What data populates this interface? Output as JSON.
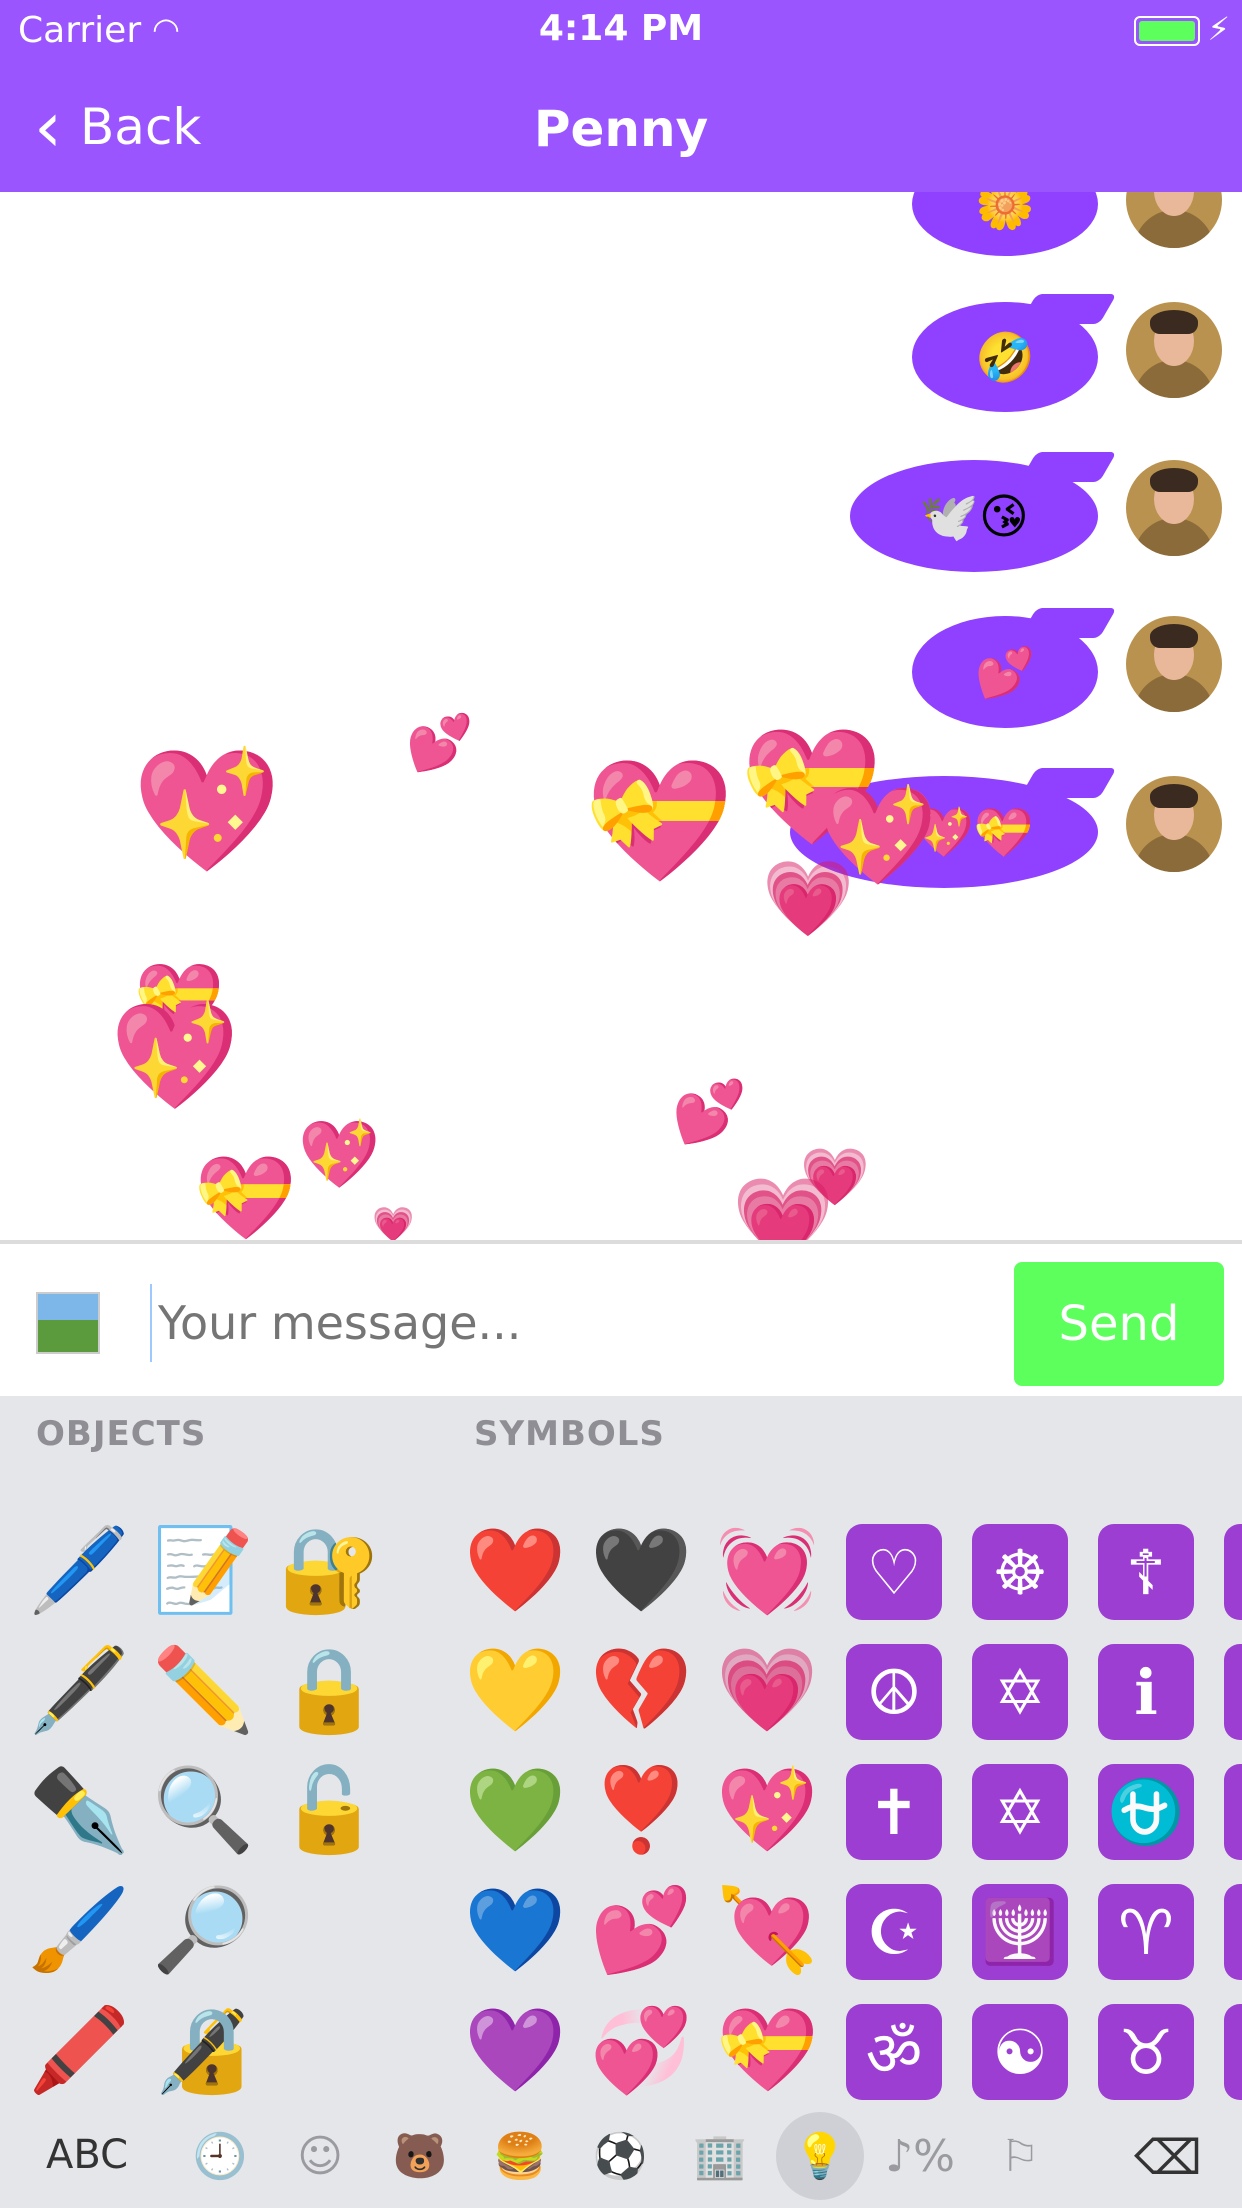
{
  "status_bar": {
    "carrier": "Carrier",
    "time": "4:14 PM"
  },
  "nav": {
    "back_label": "Back",
    "title": "Penny"
  },
  "messages": [
    {
      "content": "🌼"
    },
    {
      "content": "🤣"
    },
    {
      "content": "🕊️😘"
    },
    {
      "content": "💕"
    },
    {
      "content": "💖💖💝"
    }
  ],
  "input": {
    "placeholder": "Your message...",
    "send_label": "Send"
  },
  "keyboard": {
    "section_objects": "OBJECTS",
    "section_symbols": "SYMBOLS",
    "objects": [
      "🖊️",
      "📝",
      "🔐",
      "🖋️",
      "✏️",
      "🔒",
      "✒️",
      "🔍",
      "🔓",
      "🖌️",
      "🔎",
      "",
      "🖍️",
      "🔏",
      ""
    ],
    "hearts": [
      "❤️",
      "🖤",
      "💓",
      "💛",
      "💔",
      "💗",
      "💚",
      "❣️",
      "💖",
      "💙",
      "💕",
      "💘",
      "💜",
      "💞",
      "💝"
    ],
    "symbols": [
      "♡",
      "☸",
      "☦",
      "☮",
      "✡",
      "ℹ",
      "✝",
      "✡",
      "⛎",
      "☪",
      "🕎",
      "♈",
      "ॐ",
      "☯",
      "♉"
    ],
    "abc_label": "ABC",
    "tabs": [
      "🕘",
      "☺",
      "🐻",
      "🍔",
      "⚽",
      "🏢",
      "💡",
      "♪%",
      "⚐"
    ],
    "delete_icon": "⌫"
  }
}
